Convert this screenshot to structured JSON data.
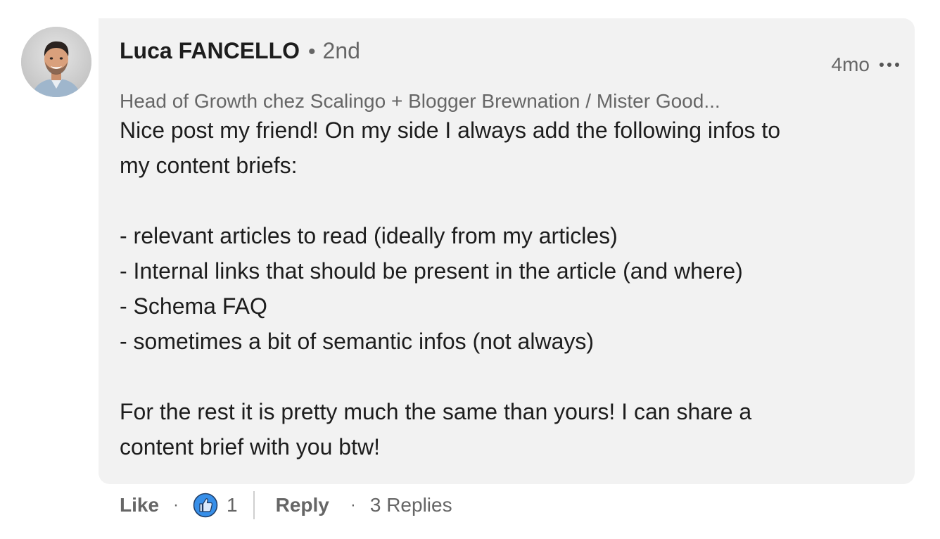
{
  "comment": {
    "author": {
      "name": "Luca FANCELLO",
      "connection_degree": "2nd",
      "headline": "Head of Growth chez Scalingo + Blogger Brewnation / Mister Good..."
    },
    "timestamp": "4mo",
    "separator_dot": "•",
    "body_paragraphs": [
      "Nice post my friend! On my side I always add the following infos to\nmy content briefs:",
      "- relevant articles to read (ideally from my articles)\n- Internal links that should be present in the article (and where)\n- Schema FAQ\n- sometimes a bit of semantic infos (not always)",
      "For the rest it is pretty much the same than yours! I can share a\ncontent brief with you btw!"
    ]
  },
  "actions": {
    "like_label": "Like",
    "reaction_icon": "thumbs-up-icon",
    "reaction_count": "1",
    "reply_label": "Reply",
    "replies_label": "3 Replies",
    "separator": "·"
  },
  "colors": {
    "bubble_background": "#f2f2f2",
    "secondary_text": "#666666",
    "primary_text": "#1d1d1d",
    "reaction_blue": "#378fe9"
  }
}
